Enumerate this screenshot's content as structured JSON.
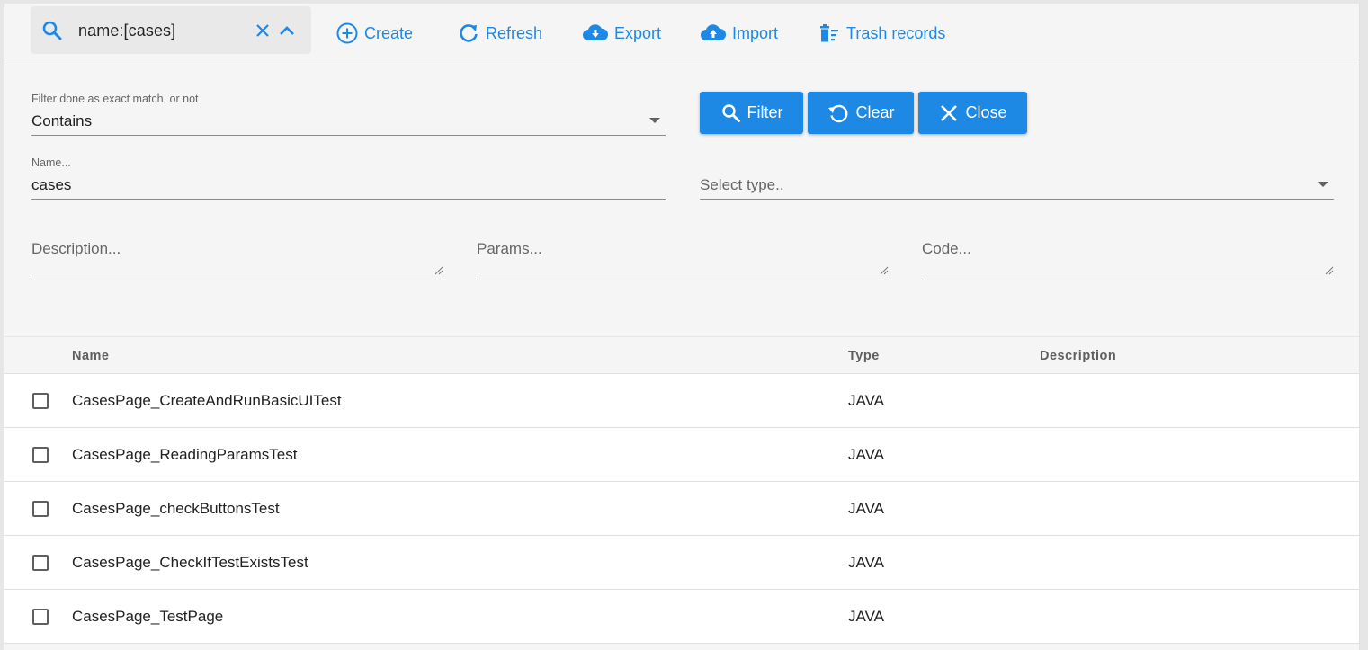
{
  "search": {
    "query": "name:[cases]"
  },
  "toolbar": {
    "create_label": "Create",
    "refresh_label": "Refresh",
    "export_label": "Export",
    "import_label": "Import",
    "trash_label": "Trash records"
  },
  "filter": {
    "match_label": "Filter done as exact match, or not",
    "match_value": "Contains",
    "name_label": "Name...",
    "name_value": "cases",
    "type_placeholder": "Select type..",
    "description_placeholder": "Description...",
    "params_placeholder": "Params...",
    "code_placeholder": "Code...",
    "filter_button": "Filter",
    "clear_button": "Clear",
    "close_button": "Close"
  },
  "table": {
    "headers": {
      "name": "Name",
      "type": "Type",
      "description": "Description"
    },
    "rows": [
      {
        "name": "CasesPage_CreateAndRunBasicUITest",
        "type": "JAVA",
        "description": ""
      },
      {
        "name": "CasesPage_ReadingParamsTest",
        "type": "JAVA",
        "description": ""
      },
      {
        "name": "CasesPage_checkButtonsTest",
        "type": "JAVA",
        "description": ""
      },
      {
        "name": "CasesPage_CheckIfTestExistsTest",
        "type": "JAVA",
        "description": ""
      },
      {
        "name": "CasesPage_TestPage",
        "type": "JAVA",
        "description": ""
      }
    ]
  },
  "colors": {
    "accent": "#1e88e5",
    "background": "#f5f5f5",
    "row_background": "#ffffff"
  },
  "icons": [
    "search-icon",
    "clear-search-icon",
    "collapse-icon",
    "add-circle-icon",
    "refresh-icon",
    "cloud-download-icon",
    "cloud-upload-icon",
    "trash-icon",
    "dropdown-caret-icon",
    "reset-icon",
    "close-icon"
  ]
}
